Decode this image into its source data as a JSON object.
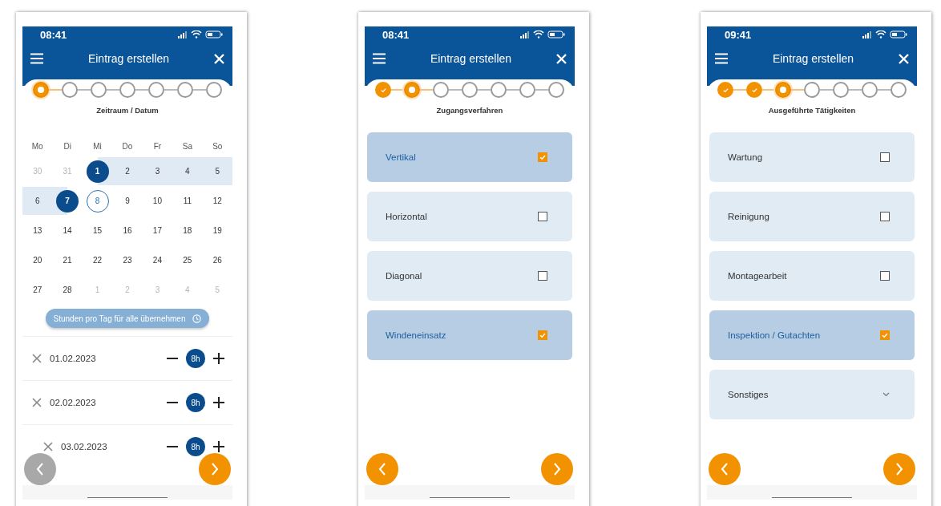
{
  "screens": [
    {
      "time": "08:41",
      "title": "Eintrag erstellen",
      "steps": [
        {
          "done": false,
          "current": true
        },
        {
          "done": false,
          "current": false
        },
        {
          "done": false,
          "current": false
        },
        {
          "done": false,
          "current": false
        },
        {
          "done": false,
          "current": false
        },
        {
          "done": false,
          "current": false
        },
        {
          "done": false,
          "current": false
        }
      ],
      "step_label": "Zeitraum / Datum",
      "kind": "calendar",
      "calendar": {
        "weekdays": [
          "Mo",
          "Di",
          "Mi",
          "Do",
          "Fr",
          "Sa",
          "So"
        ],
        "weeks": [
          [
            {
              "label": "30",
              "muted": true,
              "selected": false,
              "today": false,
              "in_range": false
            },
            {
              "label": "31",
              "muted": true,
              "selected": false,
              "today": false,
              "in_range": false
            },
            {
              "label": "1",
              "muted": false,
              "selected": true,
              "today": false,
              "in_range": true
            },
            {
              "label": "2",
              "muted": false,
              "selected": false,
              "today": false,
              "in_range": true
            },
            {
              "label": "3",
              "muted": false,
              "selected": false,
              "today": false,
              "in_range": true
            },
            {
              "label": "4",
              "muted": false,
              "selected": false,
              "today": false,
              "in_range": true
            },
            {
              "label": "5",
              "muted": false,
              "selected": false,
              "today": false,
              "in_range": true
            }
          ],
          [
            {
              "label": "6",
              "muted": false,
              "selected": false,
              "today": false,
              "in_range": true
            },
            {
              "label": "7",
              "muted": false,
              "selected": true,
              "today": false,
              "in_range": true
            },
            {
              "label": "8",
              "muted": false,
              "selected": false,
              "today": true,
              "in_range": false
            },
            {
              "label": "9",
              "muted": false,
              "selected": false,
              "today": false,
              "in_range": false
            },
            {
              "label": "10",
              "muted": false,
              "selected": false,
              "today": false,
              "in_range": false
            },
            {
              "label": "11",
              "muted": false,
              "selected": false,
              "today": false,
              "in_range": false
            },
            {
              "label": "12",
              "muted": false,
              "selected": false,
              "today": false,
              "in_range": false
            }
          ],
          [
            {
              "label": "13",
              "muted": false,
              "selected": false,
              "today": false,
              "in_range": false
            },
            {
              "label": "14",
              "muted": false,
              "selected": false,
              "today": false,
              "in_range": false
            },
            {
              "label": "15",
              "muted": false,
              "selected": false,
              "today": false,
              "in_range": false
            },
            {
              "label": "16",
              "muted": false,
              "selected": false,
              "today": false,
              "in_range": false
            },
            {
              "label": "17",
              "muted": false,
              "selected": false,
              "today": false,
              "in_range": false
            },
            {
              "label": "18",
              "muted": false,
              "selected": false,
              "today": false,
              "in_range": false
            },
            {
              "label": "19",
              "muted": false,
              "selected": false,
              "today": false,
              "in_range": false
            }
          ],
          [
            {
              "label": "20",
              "muted": false,
              "selected": false,
              "today": false,
              "in_range": false
            },
            {
              "label": "21",
              "muted": false,
              "selected": false,
              "today": false,
              "in_range": false
            },
            {
              "label": "22",
              "muted": false,
              "selected": false,
              "today": false,
              "in_range": false
            },
            {
              "label": "23",
              "muted": false,
              "selected": false,
              "today": false,
              "in_range": false
            },
            {
              "label": "24",
              "muted": false,
              "selected": false,
              "today": false,
              "in_range": false
            },
            {
              "label": "25",
              "muted": false,
              "selected": false,
              "today": false,
              "in_range": false
            },
            {
              "label": "26",
              "muted": false,
              "selected": false,
              "today": false,
              "in_range": false
            }
          ],
          [
            {
              "label": "27",
              "muted": false,
              "selected": false,
              "today": false,
              "in_range": false
            },
            {
              "label": "28",
              "muted": false,
              "selected": false,
              "today": false,
              "in_range": false
            },
            {
              "label": "1",
              "muted": true,
              "selected": false,
              "today": false,
              "in_range": false
            },
            {
              "label": "2",
              "muted": true,
              "selected": false,
              "today": false,
              "in_range": false
            },
            {
              "label": "3",
              "muted": true,
              "selected": false,
              "today": false,
              "in_range": false
            },
            {
              "label": "4",
              "muted": true,
              "selected": false,
              "today": false,
              "in_range": false
            },
            {
              "label": "5",
              "muted": true,
              "selected": false,
              "today": false,
              "in_range": false
            }
          ]
        ]
      },
      "apply_button": "Stunden pro Tag für alle übernehmen",
      "hour_rows": [
        {
          "date": "01.02.2023",
          "hours": "8h"
        },
        {
          "date": "02.02.2023",
          "hours": "8h"
        },
        {
          "date": "03.02.2023",
          "hours": "8h"
        }
      ],
      "back_disabled": true
    },
    {
      "time": "08:41",
      "title": "Eintrag erstellen",
      "steps": [
        {
          "done": true,
          "current": false
        },
        {
          "done": false,
          "current": true
        },
        {
          "done": false,
          "current": false
        },
        {
          "done": false,
          "current": false
        },
        {
          "done": false,
          "current": false
        },
        {
          "done": false,
          "current": false
        },
        {
          "done": false,
          "current": false
        }
      ],
      "step_label": "Zugangsverfahren",
      "kind": "options",
      "options": [
        {
          "kind": "checkbox",
          "label": "Vertikal",
          "checked": true
        },
        {
          "kind": "checkbox",
          "label": "Horizontal",
          "checked": false
        },
        {
          "kind": "checkbox",
          "label": "Diagonal",
          "checked": false
        },
        {
          "kind": "checkbox",
          "label": "Windeneinsatz",
          "checked": true
        }
      ],
      "back_disabled": false
    },
    {
      "time": "09:41",
      "title": "Eintrag erstellen",
      "steps": [
        {
          "done": true,
          "current": false
        },
        {
          "done": true,
          "current": false
        },
        {
          "done": false,
          "current": true
        },
        {
          "done": false,
          "current": false
        },
        {
          "done": false,
          "current": false
        },
        {
          "done": false,
          "current": false
        },
        {
          "done": false,
          "current": false
        }
      ],
      "step_label": "Ausgeführte Tätigkeiten",
      "kind": "options",
      "options": [
        {
          "kind": "checkbox",
          "label": "Wartung",
          "checked": false
        },
        {
          "kind": "checkbox",
          "label": "Reinigung",
          "checked": false
        },
        {
          "kind": "checkbox",
          "label": "Montagearbeit",
          "checked": false
        },
        {
          "kind": "checkbox",
          "label": "Inspektion / Gutachten",
          "checked": true
        },
        {
          "kind": "dropdown",
          "label": "Sonstiges"
        }
      ],
      "back_disabled": false
    }
  ]
}
